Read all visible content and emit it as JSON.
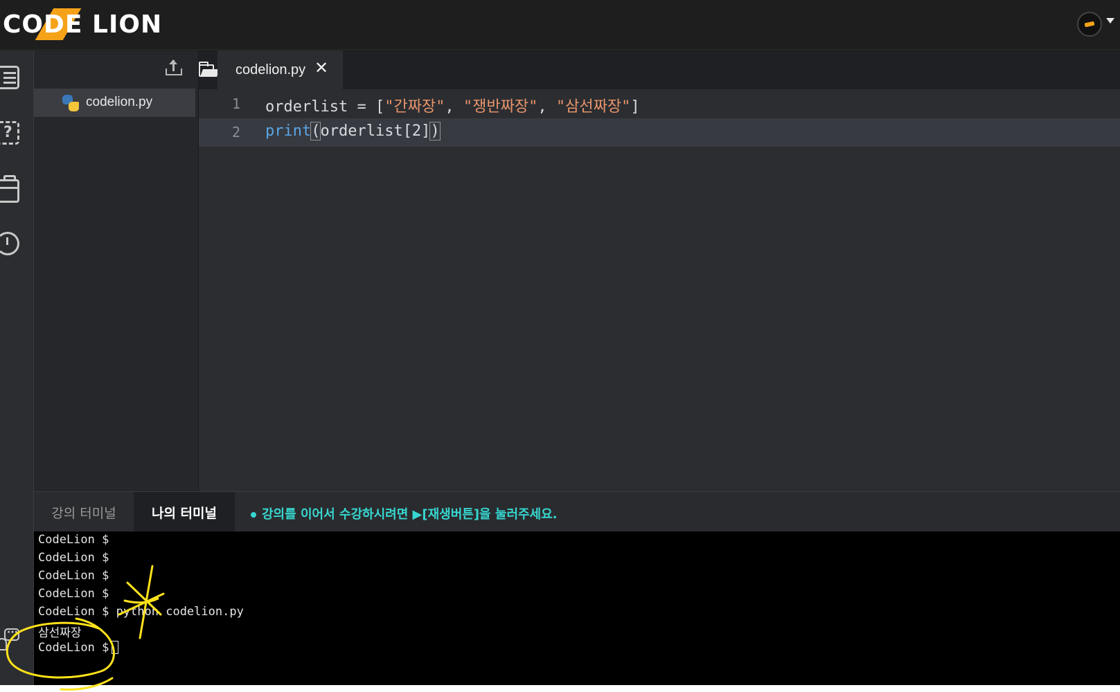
{
  "header": {
    "logo_text": "CODE LION",
    "brand_color": "#f5a219",
    "avatar_icon": "lion-avatar-icon",
    "menu_caret_icon": "caret-down-icon"
  },
  "rail": {
    "icons": [
      "list-icon",
      "help-icon",
      "briefcase-icon",
      "history-icon",
      "chat-icon"
    ]
  },
  "explorer": {
    "upload_icon": "upload-icon",
    "files": [
      {
        "name": "codelion.py",
        "icon": "python-icon"
      }
    ]
  },
  "editor": {
    "folder_icon": "folder-icon",
    "tab": {
      "label": "codelion.py",
      "close": "✕"
    },
    "lines": [
      {
        "number": "1",
        "code": "orderlist = [\"간짜장\", \"쟁반짜장\", \"삼선짜장\"]"
      },
      {
        "number": "2",
        "code": "print(orderlist[2])"
      }
    ],
    "colors": {
      "string": "#e9956b",
      "keyword": "#5aa5e6"
    }
  },
  "terminal": {
    "tabs": {
      "lecture": "강의 터미널",
      "mine": "나의 터미널"
    },
    "notice": "강의를 이어서 수강하시려면 ▶[재생버튼]을 눌러주세요.",
    "notice_color": "#37d7d1",
    "lines": [
      "CodeLion $",
      "CodeLion $",
      "CodeLion $",
      "CodeLion $",
      "CodeLion $ python codelion.py",
      "삼선짜장",
      "CodeLion $"
    ]
  }
}
